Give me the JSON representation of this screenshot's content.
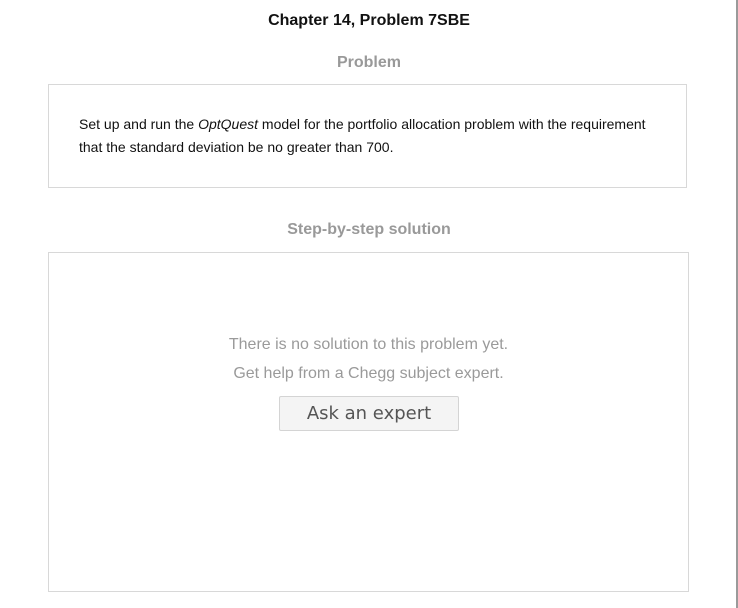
{
  "header": {
    "chapter_title": "Chapter 14, Problem 7SBE"
  },
  "problem": {
    "heading": "Problem",
    "text_before": "Set up and run the ",
    "text_italic": "OptQuest",
    "text_after": " model for the portfolio allocation problem with the requirement that the standard deviation be no greater than 700."
  },
  "solution": {
    "heading": "Step-by-step solution",
    "message_line1": "There is no solution to this problem yet.",
    "message_line2": "Get help from a Chegg subject expert.",
    "ask_button_label": "Ask an expert"
  }
}
